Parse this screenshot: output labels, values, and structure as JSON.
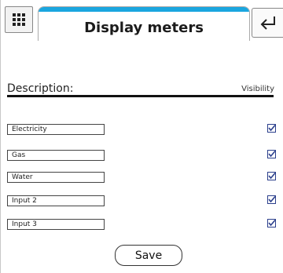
{
  "header": {
    "title": "Display meters",
    "accent_color": "#1aa6df",
    "menu_icon": "grid-menu-icon",
    "back_icon": "return-arrow-icon"
  },
  "table": {
    "description_label": "Description:",
    "visibility_label": "Visibility"
  },
  "meters": [
    {
      "name": "Electricity",
      "visible": true
    },
    {
      "name": "Gas",
      "visible": true
    },
    {
      "name": "Water",
      "visible": true
    },
    {
      "name": "Input 2",
      "visible": true
    },
    {
      "name": "Input 3",
      "visible": true
    }
  ],
  "actions": {
    "save_label": "Save"
  }
}
